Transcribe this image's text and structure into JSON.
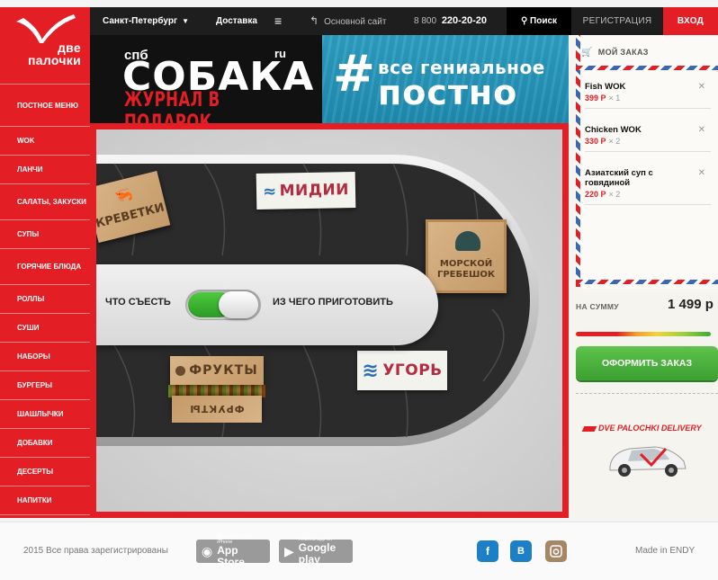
{
  "brand": {
    "logo_line1": "две",
    "logo_line2": "палочки",
    "red": "#e31e24"
  },
  "topbar": {
    "city": "Санкт-Петербург",
    "delivery": "Доставка",
    "menu_icon": "hamburger-icon",
    "main_site": "Основной сайт",
    "phone_prefix": "8 800",
    "phone_number": "220-20-20",
    "search": "Поиск",
    "register": "РЕГИСТРАЦИЯ",
    "login": "ВХОД"
  },
  "sidebar": {
    "items": [
      {
        "label": "ПОСТНОЕ МЕНЮ"
      },
      {
        "label": "WOK"
      },
      {
        "label": "ЛАНЧИ"
      },
      {
        "label": "САЛАТЫ, ЗАКУСКИ"
      },
      {
        "label": "СУПЫ"
      },
      {
        "label": "ГОРЯЧИЕ БЛЮДА"
      },
      {
        "label": "РОЛЛЫ"
      },
      {
        "label": "СУШИ"
      },
      {
        "label": "НАБОРЫ"
      },
      {
        "label": "БУРГЕРЫ"
      },
      {
        "label": "ШАШЛЫЧКИ"
      },
      {
        "label": "ДОБАВКИ"
      },
      {
        "label": "ДЕСЕРТЫ"
      },
      {
        "label": "НАПИТКИ"
      }
    ]
  },
  "banners": {
    "sobaka": {
      "small": "спб",
      "big": "СОБАКА",
      "ru": "ru",
      "gift": "ЖУРНАЛ В ПОДАРОК"
    },
    "postno": {
      "hash": "#",
      "line1": "все гениальное",
      "line2": "постно"
    }
  },
  "conveyor": {
    "toggle_left": "ЧТО СЪЕСТЬ",
    "toggle_right": "ИЗ ЧЕГО ПРИГОТОВИТЬ",
    "labels": {
      "krevetki": "КРЕВЕТКИ",
      "midii": "МИДИИ",
      "grebeshok_line1": "МОРСКОЙ",
      "grebeshok_line2": "ГРЕБЕШОК",
      "ugor": "УГОРЬ",
      "frukty": "ФРУКТЫ",
      "frukty2": "ФРУКТЫ"
    }
  },
  "order": {
    "title": "МОЙ ЗАКАЗ",
    "items": [
      {
        "name": "Fish WOK",
        "price": "399 Р",
        "qty": "× 1"
      },
      {
        "name": "Chicken WOK",
        "price": "330 Р",
        "qty": "× 2"
      },
      {
        "name": "Азиатский суп с говядиной",
        "price": "220 Р",
        "qty": "× 2"
      }
    ],
    "sum_label": "НА СУММУ",
    "sum_value": "1 499 р",
    "checkout": "ОФОРМИТЬ ЗАКАЗ",
    "delivery_brand": "DVE PALOCHKI DELIVERY"
  },
  "footer": {
    "copyright": "2015 Все права зарегистрированы",
    "appstore_small": "Available on the iPhone",
    "appstore_big": "App Store",
    "gplay_small": "Android app on",
    "gplay_big": "Google play",
    "social": {
      "fb": "f",
      "vk": "B"
    },
    "made_in": "Made in ENDY"
  }
}
